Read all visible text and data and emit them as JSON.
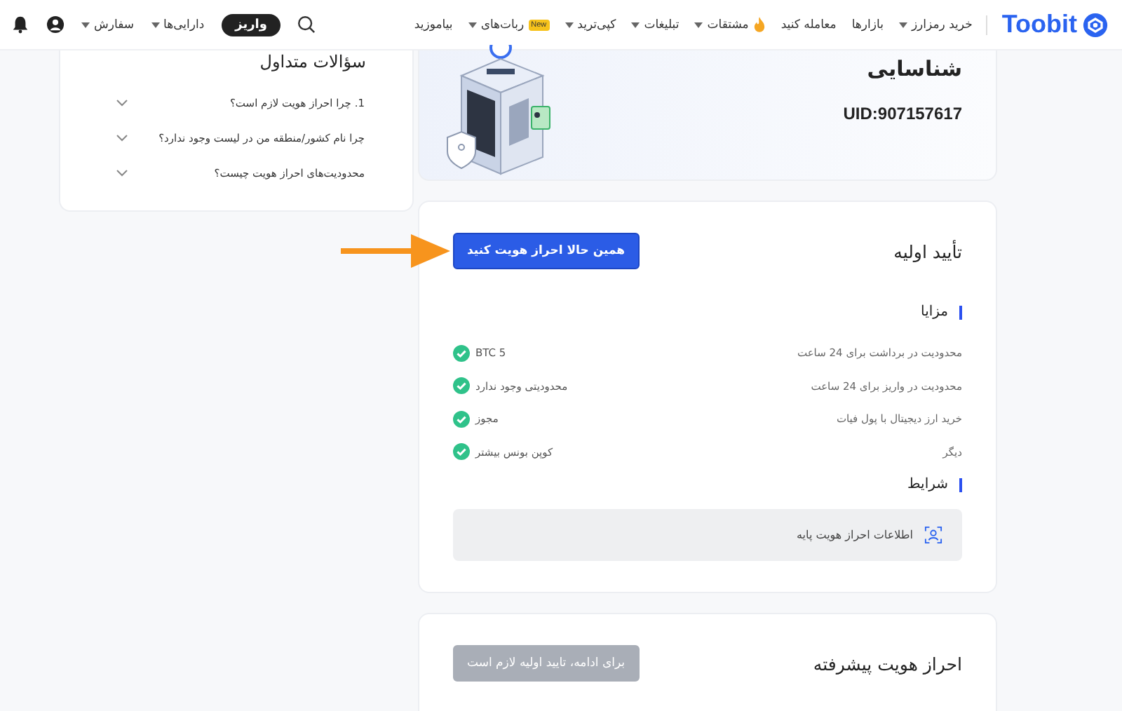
{
  "header": {
    "logo": "Toobit",
    "nav": [
      {
        "label": "خرید رمزارز",
        "caret": true,
        "kind": "plain"
      },
      {
        "label": "بازارها",
        "caret": false,
        "kind": "plain"
      },
      {
        "label": "معامله کنید",
        "caret": false,
        "kind": "plain"
      },
      {
        "label": "مشتقات",
        "caret": true,
        "kind": "hot"
      },
      {
        "label": "تبلیغات",
        "caret": true,
        "kind": "plain"
      },
      {
        "label": "کپی‌ترید",
        "caret": true,
        "kind": "plain"
      },
      {
        "label": "ربات‌های",
        "caret": true,
        "kind": "plain",
        "badge": "New"
      },
      {
        "label": "بیاموزید",
        "caret": false,
        "kind": "plain"
      }
    ],
    "deposit_button": "واریز",
    "menus": [
      {
        "label": "دارایی‌ها",
        "caret": true
      },
      {
        "label": "سفارش",
        "caret": true
      }
    ]
  },
  "identity": {
    "title": "شناسایی",
    "uid": "UID:907157617"
  },
  "basic_verification": {
    "title": "تأیید اولیه",
    "button": "همین حالا احراز هویت کنید",
    "benefits_title": "مزایا",
    "benefits": [
      {
        "label": "محدودیت در برداشت برای 24 ساعت",
        "value": "BTC 5",
        "checked": true
      },
      {
        "label": "محدودیت در واریز برای 24 ساعت",
        "value": "محدودیتی وجود ندارد",
        "checked": true
      },
      {
        "label": "خرید ارز دیجیتال با پول فیات",
        "value": "مجوز",
        "checked": true
      },
      {
        "label": "دیگر",
        "value": "کوپن بونس بیشتر",
        "checked": true
      }
    ],
    "conditions_title": "شرایط",
    "requirement": "اطلاعات احراز هویت پایه"
  },
  "advanced_verification": {
    "title": "احراز هویت پیشرفته",
    "button": {
      "label": "برای ادامه، تایید اولیه لازم است",
      "disabled": true
    }
  },
  "faq": {
    "title": "سؤالات متداول",
    "items": [
      {
        "question": "1. چرا احراز هویت لازم است؟",
        "expanded": false
      },
      {
        "question": "چرا نام کشور/منطقه من در لیست وجود ندارد؟",
        "expanded": false
      },
      {
        "question": "محدودیت‌های احراز هویت چیست؟",
        "expanded": false
      }
    ]
  }
}
